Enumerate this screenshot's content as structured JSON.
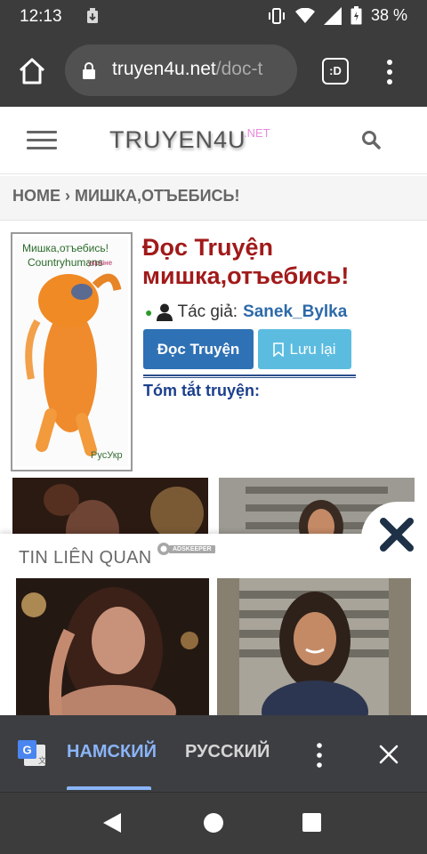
{
  "status": {
    "time": "12:13",
    "battery": "38 %"
  },
  "browser": {
    "url_host": "truyen4u.net",
    "url_path": "/doc-t",
    "tabs_label": ":D"
  },
  "site": {
    "logo": "TRUYEN4U",
    "logo_suffix": ".NET",
    "breadcrumb": "HOME › МИШКА,ОТЪЕБИСЬ!"
  },
  "story": {
    "title": "Đọc Truyện мишка,отъебись!",
    "author_label": "Tác giả:",
    "author_name": "Sanek_Bylka",
    "read_button": "Đọc Truyện",
    "save_button": "Lưu lại",
    "summary_label": "Tóm tắt truyện:",
    "cover": {
      "line1": "Мишка,отъебись!",
      "line2": "Countryhumans",
      "tag": "украіне",
      "footer": "РусУкр"
    }
  },
  "ad": {
    "related_title": "TIN LIÊN QUAN",
    "network": "ADSKEEPER"
  },
  "translate": {
    "active_language": "НАМСКИЙ",
    "other_language": "РУССКИЙ"
  }
}
